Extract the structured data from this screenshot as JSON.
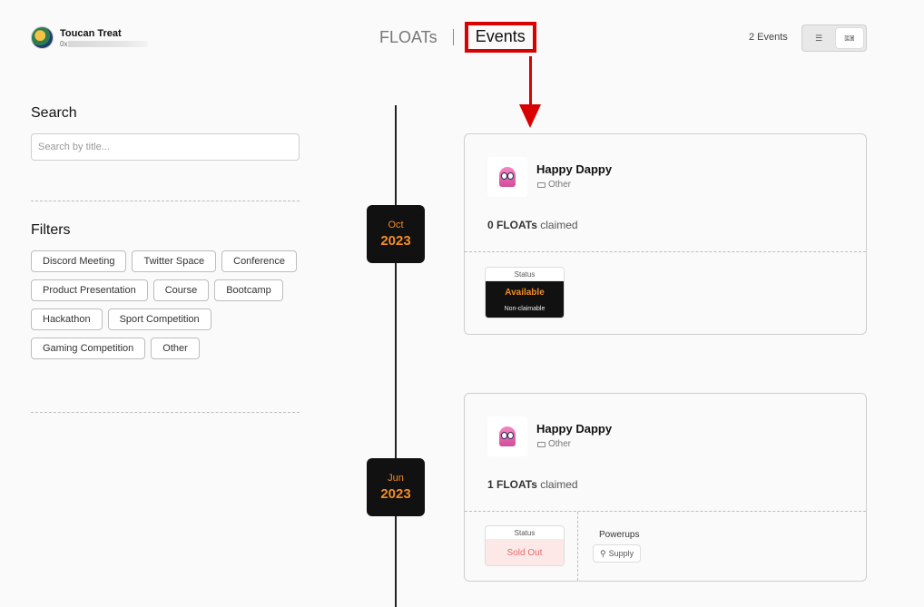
{
  "user": {
    "name": "Toucan Treat",
    "address_prefix": "0x"
  },
  "nav": {
    "floats_label": "FLOATs",
    "events_label": "Events"
  },
  "header": {
    "event_count": "2 Events",
    "list_view_icon": "list-icon",
    "card_view_icon": "ticket-icon"
  },
  "search": {
    "title": "Search",
    "placeholder": "Search by title..."
  },
  "filters": {
    "title": "Filters",
    "items": [
      "Discord Meeting",
      "Twitter Space",
      "Conference",
      "Product Presentation",
      "Course",
      "Bootcamp",
      "Hackathon",
      "Sport Competition",
      "Gaming Competition",
      "Other"
    ]
  },
  "colors": {
    "accent": "#f28c28",
    "highlight": "#d90000",
    "sold_out": "#e46b6b"
  },
  "events": [
    {
      "month": "Oct",
      "year": "2023",
      "title": "Happy Dappy",
      "type": "Other",
      "claimed_count": "0 FLOATs",
      "claimed_suffix": "claimed",
      "status_label": "Status",
      "status": "Available",
      "status_sub": "Non-claimable"
    },
    {
      "month": "Jun",
      "year": "2023",
      "title": "Happy Dappy",
      "type": "Other",
      "claimed_count": "1 FLOATs",
      "claimed_suffix": "claimed",
      "status_label": "Status",
      "status": "Sold Out",
      "powerups_label": "Powerups",
      "powerup": "Supply"
    }
  ]
}
